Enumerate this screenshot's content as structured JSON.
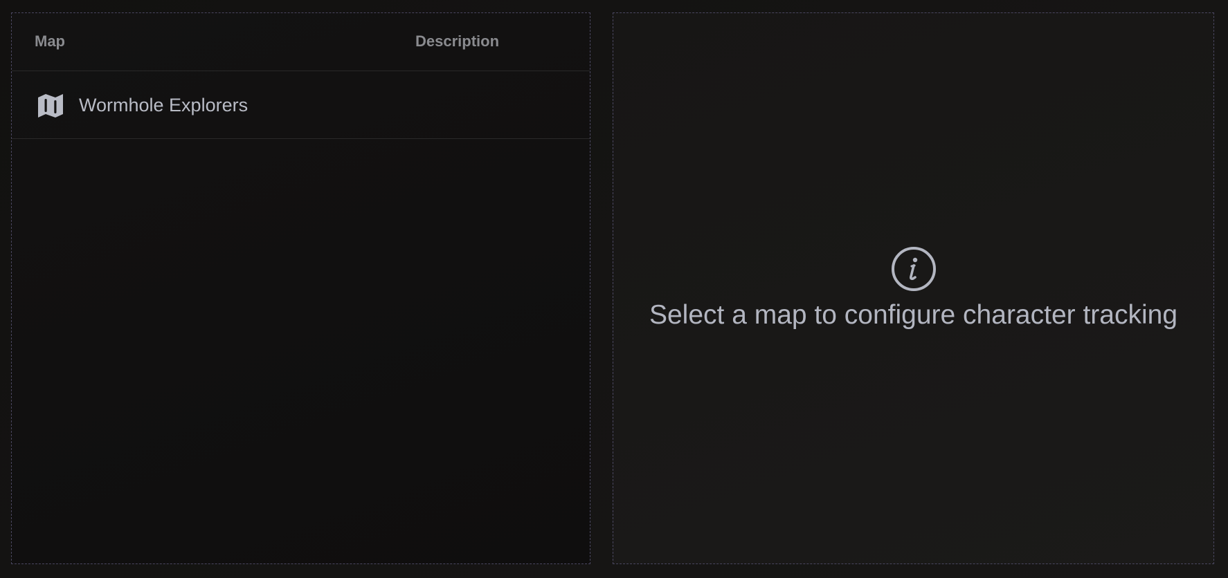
{
  "maps_table": {
    "columns": {
      "map": "Map",
      "description": "Description"
    },
    "rows": [
      {
        "name": "Wormhole Explorers",
        "description": "",
        "icon": "map-icon"
      }
    ]
  },
  "detail_panel": {
    "icon": "info-icon",
    "message": "Select a map to configure character tracking"
  },
  "colors": {
    "background": "#151413",
    "panel_border": "#4a4760",
    "text_primary": "#b9bcc6",
    "text_header": "#8a8b8f"
  }
}
